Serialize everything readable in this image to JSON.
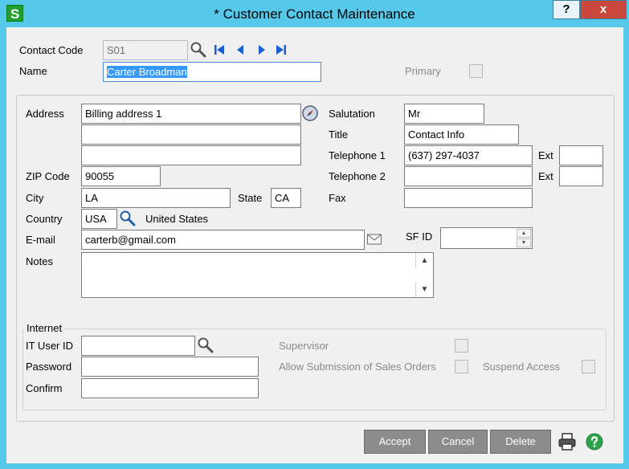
{
  "window": {
    "app_icon_letter": "S",
    "title": "* Customer Contact Maintenance",
    "help_glyph": "?",
    "close_glyph": "x"
  },
  "header": {
    "contact_code_label": "Contact Code",
    "contact_code_value": "S01",
    "name_label": "Name",
    "name_value": "Carter Broadman",
    "primary_label": "Primary"
  },
  "address": {
    "address_label": "Address",
    "line1": "Billing address 1",
    "line2": "",
    "line3": "",
    "zip_label": "ZIP Code",
    "zip_value": "90055",
    "city_label": "City",
    "city_value": "LA",
    "state_label": "State",
    "state_value": "CA",
    "country_label": "Country",
    "country_code": "USA",
    "country_name": "United States",
    "email_label": "E-mail",
    "email_value": "carterb@gmail.com",
    "notes_label": "Notes",
    "notes_value": ""
  },
  "contact": {
    "salutation_label": "Salutation",
    "salutation_value": "Mr",
    "title_label": "Title",
    "title_value": "Contact Info",
    "tel1_label": "Telephone 1",
    "tel1_value": "(637) 297-4037",
    "ext_label": "Ext",
    "ext1_value": "",
    "tel2_label": "Telephone 2",
    "tel2_value": "",
    "ext2_value": "",
    "fax_label": "Fax",
    "fax_value": "",
    "sfid_label": "SF ID",
    "sfid_value": ""
  },
  "internet": {
    "group_label": "Internet",
    "it_user_label": "IT User ID",
    "it_user_value": "",
    "password_label": "Password",
    "password_value": "",
    "confirm_label": "Confirm",
    "confirm_value": "",
    "supervisor_label": "Supervisor",
    "allow_label": "Allow Submission of Sales Orders",
    "suspend_label": "Suspend Access"
  },
  "footer": {
    "accept_label": "Accept",
    "cancel_label": "Cancel",
    "delete_label": "Delete"
  },
  "icons": [
    "app-icon",
    "help-icon",
    "close-icon",
    "lookup-icon",
    "first-record-icon",
    "previous-record-icon",
    "next-record-icon",
    "last-record-icon",
    "compass-icon",
    "email-icon",
    "printer-icon",
    "help-circle-icon"
  ],
  "colors": {
    "title_bar": "#56c8ea",
    "selection": "#3399ff",
    "nav_arrow": "#1a5fd1",
    "button": "#8c8c8c",
    "help_green": "#2fa34a"
  }
}
